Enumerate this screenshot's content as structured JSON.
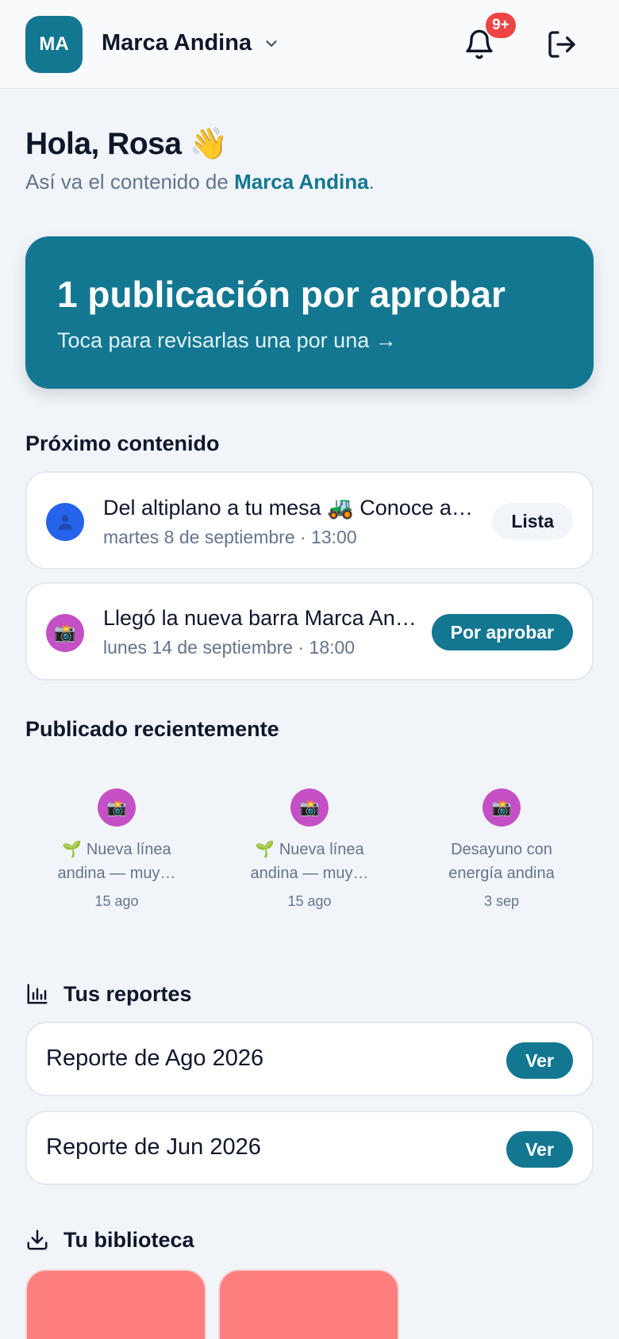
{
  "header": {
    "logo_initials": "MA",
    "brand_name": "Marca Andina",
    "notifications_badge": "9+"
  },
  "greeting": {
    "title": "Hola, Rosa 👋",
    "subtitle_prefix": "Así va el contenido de ",
    "subtitle_brand": "Marca Andina",
    "subtitle_suffix": "."
  },
  "hero": {
    "title": "1 publicación por aprobar",
    "subtitle": "Toca para revisarlas una por una →"
  },
  "upcoming": {
    "title": "Próximo contenido",
    "items": [
      {
        "title": "Del altiplano a tu mesa 🚜  Conoce a nuestros productores",
        "date": "martes 8 de septiembre · 13:00",
        "status": "Lista",
        "avatar_icon": "user-icon",
        "avatar_color": "#2563eb"
      },
      {
        "title": "Llegó la nueva barra Marca Andina",
        "date": "lunes 14 de septiembre · 18:00",
        "status": "Por aprobar",
        "avatar_icon": "camera-icon",
        "avatar_color": "#c550c5"
      }
    ]
  },
  "recent": {
    "title": "Publicado recientemente",
    "items": [
      {
        "caption": "🌱 Nueva línea andina — muy…",
        "date": "15 ago"
      },
      {
        "caption": "🌱 Nueva línea andina — muy…",
        "date": "15 ago"
      },
      {
        "caption": "Desayuno con energía andina 🌄…",
        "date": "3 sep"
      }
    ]
  },
  "reports": {
    "title": "Tus reportes",
    "items": [
      {
        "label": "Reporte de Ago 2026",
        "button": "Ver"
      },
      {
        "label": "Reporte de Jun 2026",
        "button": "Ver"
      }
    ]
  },
  "library": {
    "title": "Tu biblioteca",
    "tile_color": "#ff7f7f"
  },
  "colors": {
    "primary": "#137791",
    "badge": "#ef4444",
    "background": "#f1f5f9"
  }
}
